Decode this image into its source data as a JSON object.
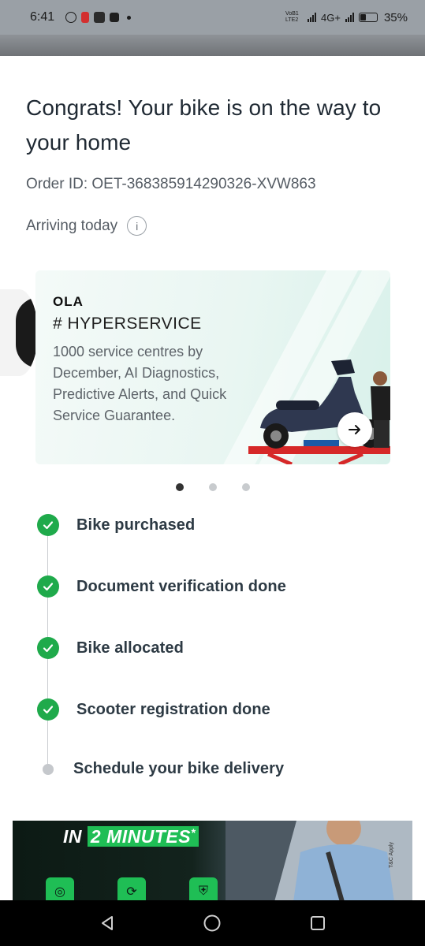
{
  "status_bar": {
    "time": "6:41",
    "network_label": "4G+",
    "volte_label": "VoB1 LTE2",
    "battery_percent": "35%"
  },
  "order": {
    "title": "Congrats! Your bike is on the way to your home",
    "order_id": "Order ID: OET-368385914290326-XVW863",
    "arriving": "Arriving today"
  },
  "banner": {
    "brand": "OLA",
    "hashtag": "# HYPERSERVICE",
    "description": "1000 service centres by December, AI Diagnostics, Predictive Alerts, and Quick Service Guarantee.",
    "active_slide": 1,
    "slide_count": 3
  },
  "timeline": {
    "steps": [
      {
        "label": "Bike purchased",
        "status": "done"
      },
      {
        "label": "Document verification done",
        "status": "done"
      },
      {
        "label": "Bike allocated",
        "status": "done"
      },
      {
        "label": "Scooter registration done",
        "status": "done"
      },
      {
        "label": "Schedule your bike delivery",
        "status": "pending"
      }
    ]
  },
  "promo": {
    "prefix": "IN",
    "highlight": "2 MINUTES",
    "suffix": "*",
    "tc": "T&C Apply"
  },
  "colors": {
    "success": "#1faa4b",
    "pending": "#c5c8cc",
    "accent": "#1fbe55"
  },
  "icons": {
    "info": "info-icon",
    "arrow": "arrow-right-icon",
    "check": "check-icon",
    "nav_back": "back-triangle-icon",
    "nav_home": "home-circle-icon",
    "nav_recents": "recents-square-icon"
  }
}
